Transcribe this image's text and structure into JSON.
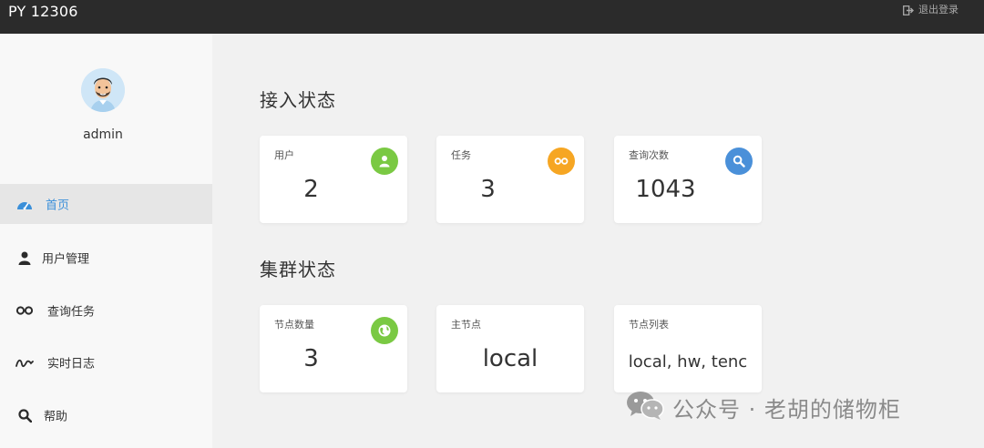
{
  "header": {
    "brand": "PY 12306",
    "logout_label": "退出登录"
  },
  "colors": {
    "accent": "#3a8fd9",
    "green": "#7ac943",
    "orange": "#f6a623",
    "blue": "#4a90d9",
    "topbar": "#2b2b2b"
  },
  "sidebar": {
    "username": "admin",
    "items": [
      {
        "label": "首页",
        "icon": "dashboard-icon",
        "active": true
      },
      {
        "label": "用户管理",
        "icon": "user-icon"
      },
      {
        "label": "查询任务",
        "icon": "infinity-icon"
      },
      {
        "label": "实时日志",
        "icon": "squiggle-icon"
      },
      {
        "label": "帮助",
        "icon": "search-icon"
      }
    ]
  },
  "sections": [
    {
      "title": "接入状态",
      "cards": [
        {
          "label": "用户",
          "value": "2",
          "icon": "user-icon"
        },
        {
          "label": "任务",
          "value": "3",
          "icon": "infinity-icon"
        },
        {
          "label": "查询次数",
          "value": "1043",
          "icon": "search-icon"
        }
      ]
    },
    {
      "title": "集群状态",
      "cards": [
        {
          "label": "节点数量",
          "value": "3",
          "icon": "globe-icon"
        },
        {
          "label": "主节点",
          "value": "local"
        },
        {
          "label": "节点列表",
          "value": "local, hw, tenc"
        }
      ]
    }
  ],
  "watermark": {
    "text": "公众号 · 老胡的储物柜"
  }
}
